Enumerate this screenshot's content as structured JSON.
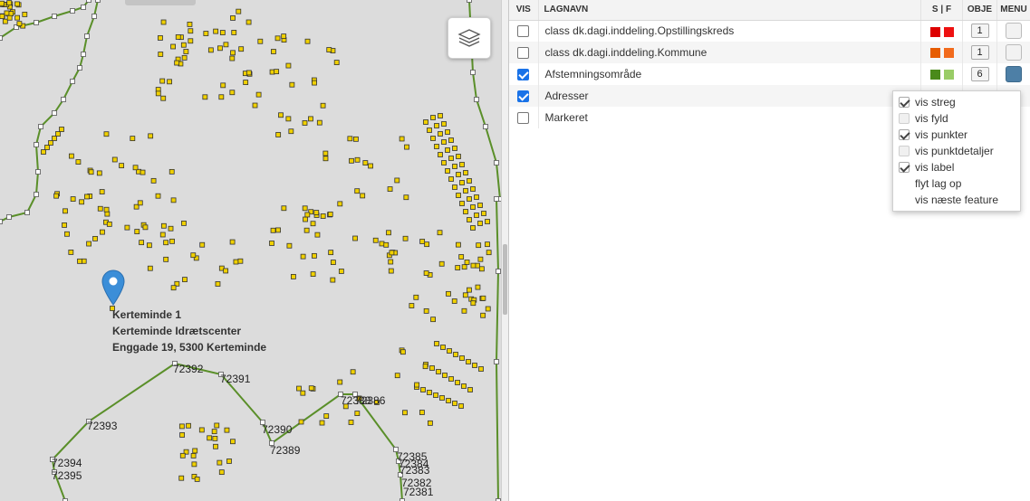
{
  "map": {
    "address_label": {
      "line1": "Kerteminde 1",
      "line2": "Kerteminde Idrætscenter",
      "line3": "Enggade 19, 5300 Kerteminde"
    },
    "polygon_labels": [
      "72392",
      "72391",
      "72393",
      "72390",
      "72389",
      "72394",
      "72395",
      "72388",
      "72386",
      "72385",
      "72384",
      "72383",
      "72382",
      "72381"
    ],
    "colors": {
      "background": "#dcdcdc",
      "boundary_line": "#5a8f29",
      "address_point": "#f0d000",
      "marker": "#3b8ed8"
    },
    "icons": {
      "layer_switcher": "layers-icon",
      "marker": "map-marker-icon"
    }
  },
  "panel": {
    "headers": {
      "vis": "VIS",
      "name": "LAGNAVN",
      "sf": "S | F",
      "obj": "OBJE",
      "menu": "MENU"
    },
    "layers": [
      {
        "visible": false,
        "name": "class dk.dagi.inddeling.Opstillingskreds",
        "stroke": "#dd0000",
        "fill": "#ee1111",
        "obj": "1",
        "menu_color": "#f2f2f2"
      },
      {
        "visible": false,
        "name": "class dk.dagi.inddeling.Kommune",
        "stroke": "#e65c00",
        "fill": "#f26b1d",
        "obj": "1",
        "menu_color": "#f2f2f2"
      },
      {
        "visible": true,
        "name": "Afstemningsområde",
        "stroke": "#4a8a1a",
        "fill": "#99cc66",
        "obj": "6",
        "menu_color": "#4d7fa6"
      },
      {
        "visible": true,
        "name": "Adresser"
      },
      {
        "visible": false,
        "name": "Markeret"
      }
    ]
  },
  "popup": {
    "items": [
      {
        "label": "vis streg",
        "checked": true
      },
      {
        "label": "vis fyld",
        "checked": false
      },
      {
        "label": "vis punkter",
        "checked": true
      },
      {
        "label": "vis punktdetaljer",
        "checked": false
      },
      {
        "label": "vis label",
        "checked": true
      }
    ],
    "actions": [
      "flyt lag op",
      "vis næste feature"
    ]
  }
}
